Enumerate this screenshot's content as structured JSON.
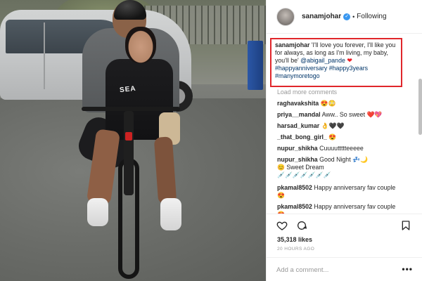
{
  "post": {
    "username": "sanamjohar",
    "following_label": "Following",
    "caption": {
      "user": "sanamjohar",
      "text": "'I'll love you forever, I'll like you for always, as long as I'm living, my baby, you'll be'",
      "mention": "@abigail_pande",
      "hashtags": "#happyanniversary #happy3years #manymoretogo"
    },
    "load_more_label": "Load more comments",
    "comments": [
      {
        "user": "raghavakshita",
        "text": "😍😳"
      },
      {
        "user": "priya__mandal",
        "text": "Aww.. So sweet ❤️💖"
      },
      {
        "user": "harsad_kumar",
        "text": "👌🖤🖤"
      },
      {
        "user": "_that_bong_girl_",
        "text": "😍"
      },
      {
        "user": "nupur_shikha",
        "text": "Cuuuuttttteeeee"
      },
      {
        "user": "nupur_shikha",
        "text": "Good Night 💤🌙"
      },
      {
        "user": "",
        "text": "😊 Sweet Dream"
      },
      {
        "user": "",
        "text": "💉💉💉💉💉💉💉"
      },
      {
        "user": "pkamal8502",
        "text": "Happy anniversary fav couple"
      },
      {
        "user": "",
        "text": "😍"
      },
      {
        "user": "pkamal8502",
        "text": "Happy anniversary fav couple"
      },
      {
        "user": "",
        "text": "😍"
      }
    ],
    "likes_label": "35,318 likes",
    "timestamp": "20 HOURS AGO",
    "add_comment_placeholder": "Add a comment...",
    "more_label": "•••"
  },
  "photo": {
    "shirt_text": "SEA"
  },
  "colors": {
    "highlight_border": "#e0262b",
    "link": "#003569",
    "verified": "#3897f0",
    "muted": "#999999"
  },
  "icons": [
    "verified-badge-icon",
    "heart-icon",
    "comment-icon",
    "bookmark-icon",
    "more-options-icon"
  ]
}
